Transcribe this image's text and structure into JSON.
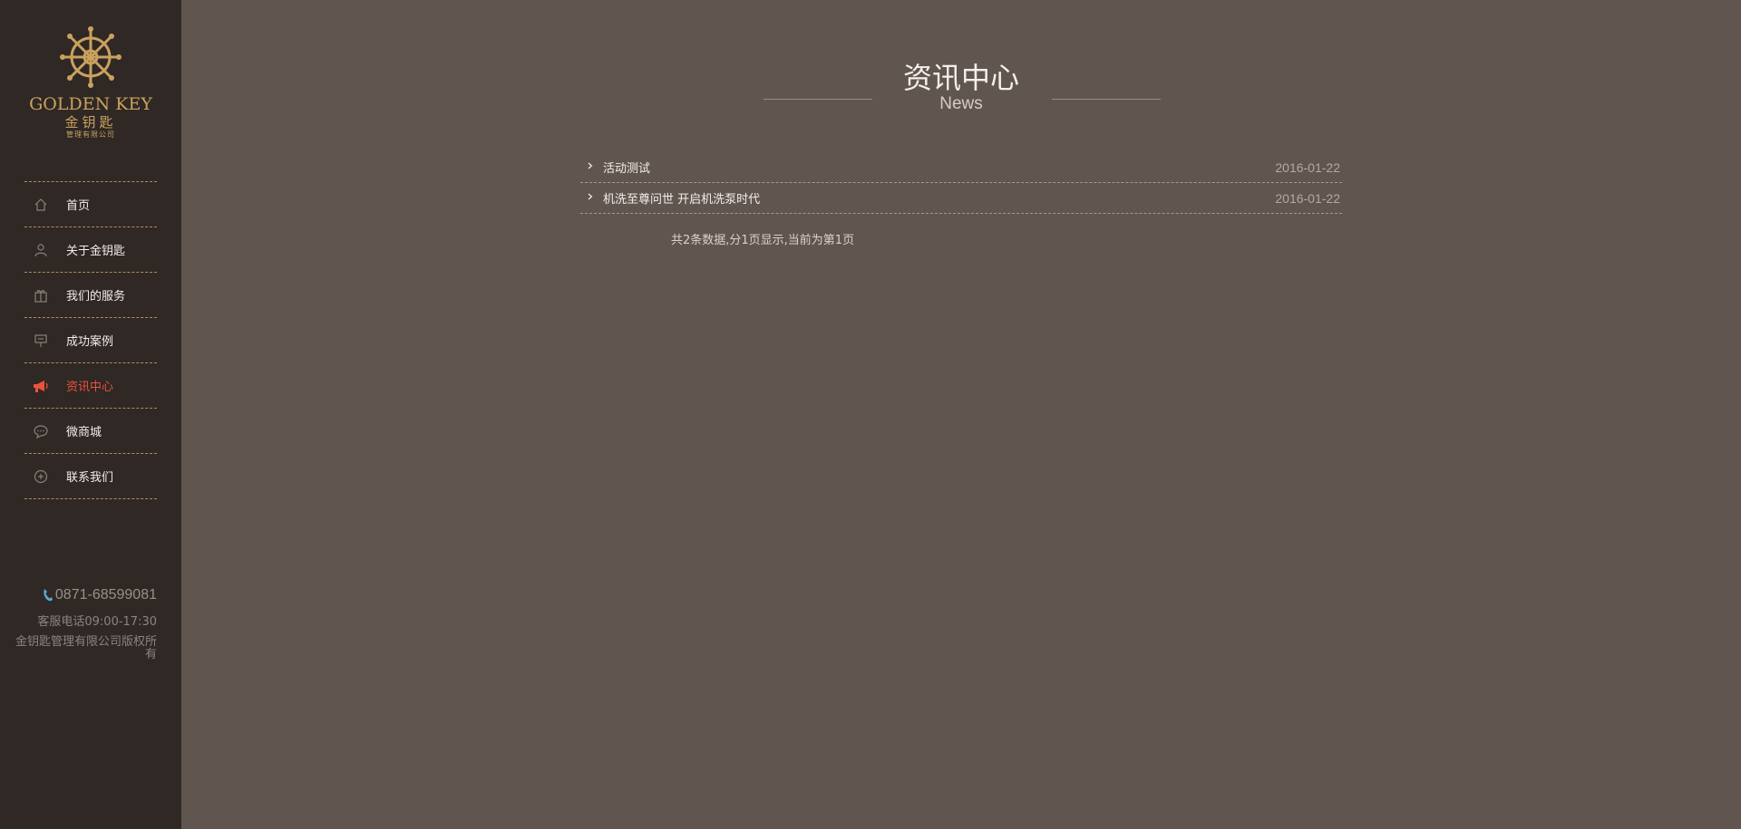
{
  "brand": {
    "name_en": "GOLDEN KEY",
    "name_cn": "金钥匙",
    "sub": "管理有限公司",
    "color": "#c9a25e"
  },
  "nav": {
    "items": [
      {
        "label": "首页",
        "icon": "home-icon"
      },
      {
        "label": "关于金钥匙",
        "icon": "user-icon"
      },
      {
        "label": "我们的服务",
        "icon": "gift-icon"
      },
      {
        "label": "成功案例",
        "icon": "signboard-icon"
      },
      {
        "label": "资讯中心",
        "icon": "megaphone-icon",
        "active": true
      },
      {
        "label": "微商城",
        "icon": "chat-bubble-icon"
      },
      {
        "label": "联系我们",
        "icon": "plus-circle-icon"
      }
    ],
    "active_color": "#e9533a"
  },
  "contact": {
    "phone": "0871-68599081",
    "hours": "客服电话09:00-17:30",
    "copyright": "金钥匙管理有限公司版权所有"
  },
  "header": {
    "title": "资讯中心",
    "subtitle": "News"
  },
  "news": [
    {
      "title": "活动测试",
      "date": "2016-01-22"
    },
    {
      "title": "机洗至尊问世 开启机洗泵时代",
      "date": "2016-01-22"
    }
  ],
  "pager": {
    "text": "共2条数据,分1页显示,当前为第1页"
  }
}
